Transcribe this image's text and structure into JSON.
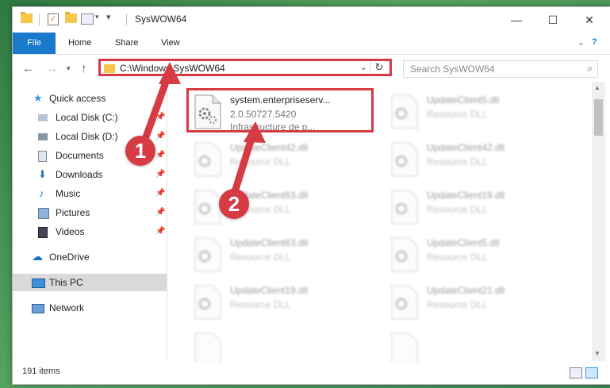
{
  "window": {
    "title": "SysWOW64"
  },
  "ribbon": {
    "file": "File",
    "tabs": [
      "Home",
      "Share",
      "View"
    ]
  },
  "address": {
    "path": "C:\\Windows\\SysWOW64"
  },
  "search": {
    "placeholder": "Search SysWOW64"
  },
  "sidebar": {
    "items": [
      {
        "label": "Quick access"
      },
      {
        "label": "Local Disk (C:)"
      },
      {
        "label": "Local Disk (D:)"
      },
      {
        "label": "Documents"
      },
      {
        "label": "Downloads"
      },
      {
        "label": "Music"
      },
      {
        "label": "Pictures"
      },
      {
        "label": "Videos"
      },
      {
        "label": "OneDrive"
      },
      {
        "label": "This PC"
      },
      {
        "label": "Network"
      }
    ]
  },
  "files": [
    {
      "name": "system.enterpriseserv...",
      "line2": "2.0.50727.5420",
      "line3": "Infrastructure de p..."
    },
    {
      "name": "UpdateClient5.dll",
      "line2": "Resource DLL"
    },
    {
      "name": "UpdateClient42.dll",
      "line2": "Resource DLL"
    },
    {
      "name": "UpdateClient42.dll",
      "line2": "Resource DLL"
    },
    {
      "name": "UpdateClient63.dll",
      "line2": "Resource DLL"
    },
    {
      "name": "UpdateClient19.dll",
      "line2": "Resource DLL"
    },
    {
      "name": "UpdateClient63.dll",
      "line2": "Resource DLL"
    },
    {
      "name": "UpdateClient5.dll",
      "line2": "Resource DLL"
    },
    {
      "name": "UpdateClient19.dll",
      "line2": "Resource DLL"
    },
    {
      "name": "UpdateClient21.dll",
      "line2": "Resource DLL"
    }
  ],
  "status": {
    "count": "191 items"
  },
  "callouts": {
    "one": "1",
    "two": "2"
  },
  "colors": {
    "accent": "#1979ca",
    "callout": "#d63a43"
  }
}
